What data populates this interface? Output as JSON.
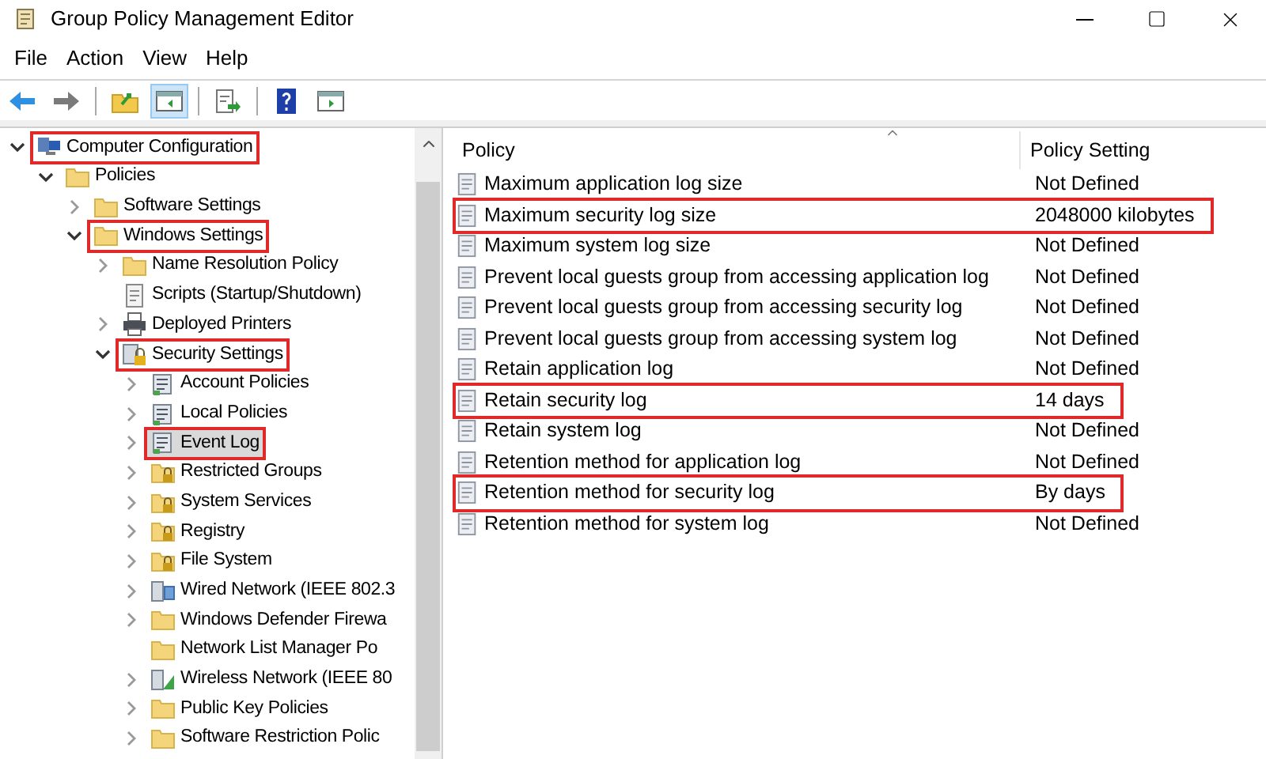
{
  "window": {
    "title": "Group Policy Management Editor"
  },
  "menu": [
    "File",
    "Action",
    "View",
    "Help"
  ],
  "toolbar": [
    {
      "kind": "back",
      "selected": false
    },
    {
      "kind": "forward",
      "selected": false
    },
    {
      "kind": "sep"
    },
    {
      "kind": "up",
      "selected": false
    },
    {
      "kind": "tree",
      "selected": true
    },
    {
      "kind": "sep"
    },
    {
      "kind": "export",
      "selected": false
    },
    {
      "kind": "sep"
    },
    {
      "kind": "help",
      "selected": false
    },
    {
      "kind": "pane",
      "selected": false
    }
  ],
  "tree": [
    {
      "label": "Computer Configuration",
      "kind": "computer",
      "expanded": true,
      "highlighted": true,
      "selected": false,
      "children": [
        {
          "label": "Policies",
          "kind": "folder",
          "expanded": true,
          "highlighted": false,
          "selected": false,
          "children": [
            {
              "label": "Software Settings",
              "kind": "folder",
              "expanded": false,
              "highlighted": false,
              "selected": false
            },
            {
              "label": "Windows Settings",
              "kind": "folder",
              "expanded": true,
              "highlighted": true,
              "selected": false,
              "children": [
                {
                  "label": "Name Resolution Policy",
                  "kind": "folder",
                  "expanded": false,
                  "highlighted": false,
                  "selected": false
                },
                {
                  "label": "Scripts (Startup/Shutdown)",
                  "kind": "script",
                  "highlighted": false,
                  "selected": false
                },
                {
                  "label": "Deployed Printers",
                  "kind": "printer",
                  "expanded": false,
                  "highlighted": false,
                  "selected": false
                },
                {
                  "label": "Security Settings",
                  "kind": "security",
                  "expanded": true,
                  "highlighted": true,
                  "selected": false,
                  "children": [
                    {
                      "label": "Account Policies",
                      "kind": "policy",
                      "expanded": false,
                      "highlighted": false,
                      "selected": false
                    },
                    {
                      "label": "Local Policies",
                      "kind": "policy",
                      "expanded": false,
                      "highlighted": false,
                      "selected": false
                    },
                    {
                      "label": "Event Log",
                      "kind": "policy",
                      "expanded": false,
                      "highlighted": true,
                      "selected": true
                    },
                    {
                      "label": "Restricted Groups",
                      "kind": "lockfolder",
                      "expanded": false,
                      "highlighted": false,
                      "selected": false
                    },
                    {
                      "label": "System Services",
                      "kind": "lockfolder",
                      "expanded": false,
                      "highlighted": false,
                      "selected": false
                    },
                    {
                      "label": "Registry",
                      "kind": "lockfolder",
                      "expanded": false,
                      "highlighted": false,
                      "selected": false
                    },
                    {
                      "label": "File System",
                      "kind": "lockfolder",
                      "expanded": false,
                      "highlighted": false,
                      "selected": false
                    },
                    {
                      "label": "Wired Network (IEEE 802.3",
                      "kind": "network",
                      "expanded": false,
                      "highlighted": false,
                      "selected": false
                    },
                    {
                      "label": "Windows Defender Firewa",
                      "kind": "folder",
                      "expanded": false,
                      "highlighted": false,
                      "selected": false
                    },
                    {
                      "label": "Network List Manager Po",
                      "kind": "folder",
                      "highlighted": false,
                      "selected": false
                    },
                    {
                      "label": "Wireless Network (IEEE 80",
                      "kind": "wireless",
                      "expanded": false,
                      "highlighted": false,
                      "selected": false
                    },
                    {
                      "label": "Public Key Policies",
                      "kind": "folder",
                      "expanded": false,
                      "highlighted": false,
                      "selected": false
                    },
                    {
                      "label": "Software Restriction Polic",
                      "kind": "folder",
                      "expanded": false,
                      "highlighted": false,
                      "selected": false
                    }
                  ]
                }
              ]
            }
          ]
        }
      ]
    }
  ],
  "table": {
    "columns": [
      "Policy",
      "Policy Setting"
    ],
    "rows": [
      {
        "policy": "Maximum application log size",
        "setting": "Not Defined",
        "highlighted": false
      },
      {
        "policy": "Maximum security log size",
        "setting": "2048000 kilobytes",
        "highlighted": true
      },
      {
        "policy": "Maximum system log size",
        "setting": "Not Defined",
        "highlighted": false
      },
      {
        "policy": "Prevent local guests group from accessing application log",
        "setting": "Not Defined",
        "highlighted": false
      },
      {
        "policy": "Prevent local guests group from accessing security log",
        "setting": "Not Defined",
        "highlighted": false
      },
      {
        "policy": "Prevent local guests group from accessing system log",
        "setting": "Not Defined",
        "highlighted": false
      },
      {
        "policy": "Retain application log",
        "setting": "Not Defined",
        "highlighted": false
      },
      {
        "policy": "Retain security log",
        "setting": "14 days",
        "highlighted": true
      },
      {
        "policy": "Retain system log",
        "setting": "Not Defined",
        "highlighted": false
      },
      {
        "policy": "Retention method for application log",
        "setting": "Not Defined",
        "highlighted": false
      },
      {
        "policy": "Retention method for security log",
        "setting": "By days",
        "highlighted": true
      },
      {
        "policy": "Retention method for system log",
        "setting": "Not Defined",
        "highlighted": false
      }
    ]
  }
}
